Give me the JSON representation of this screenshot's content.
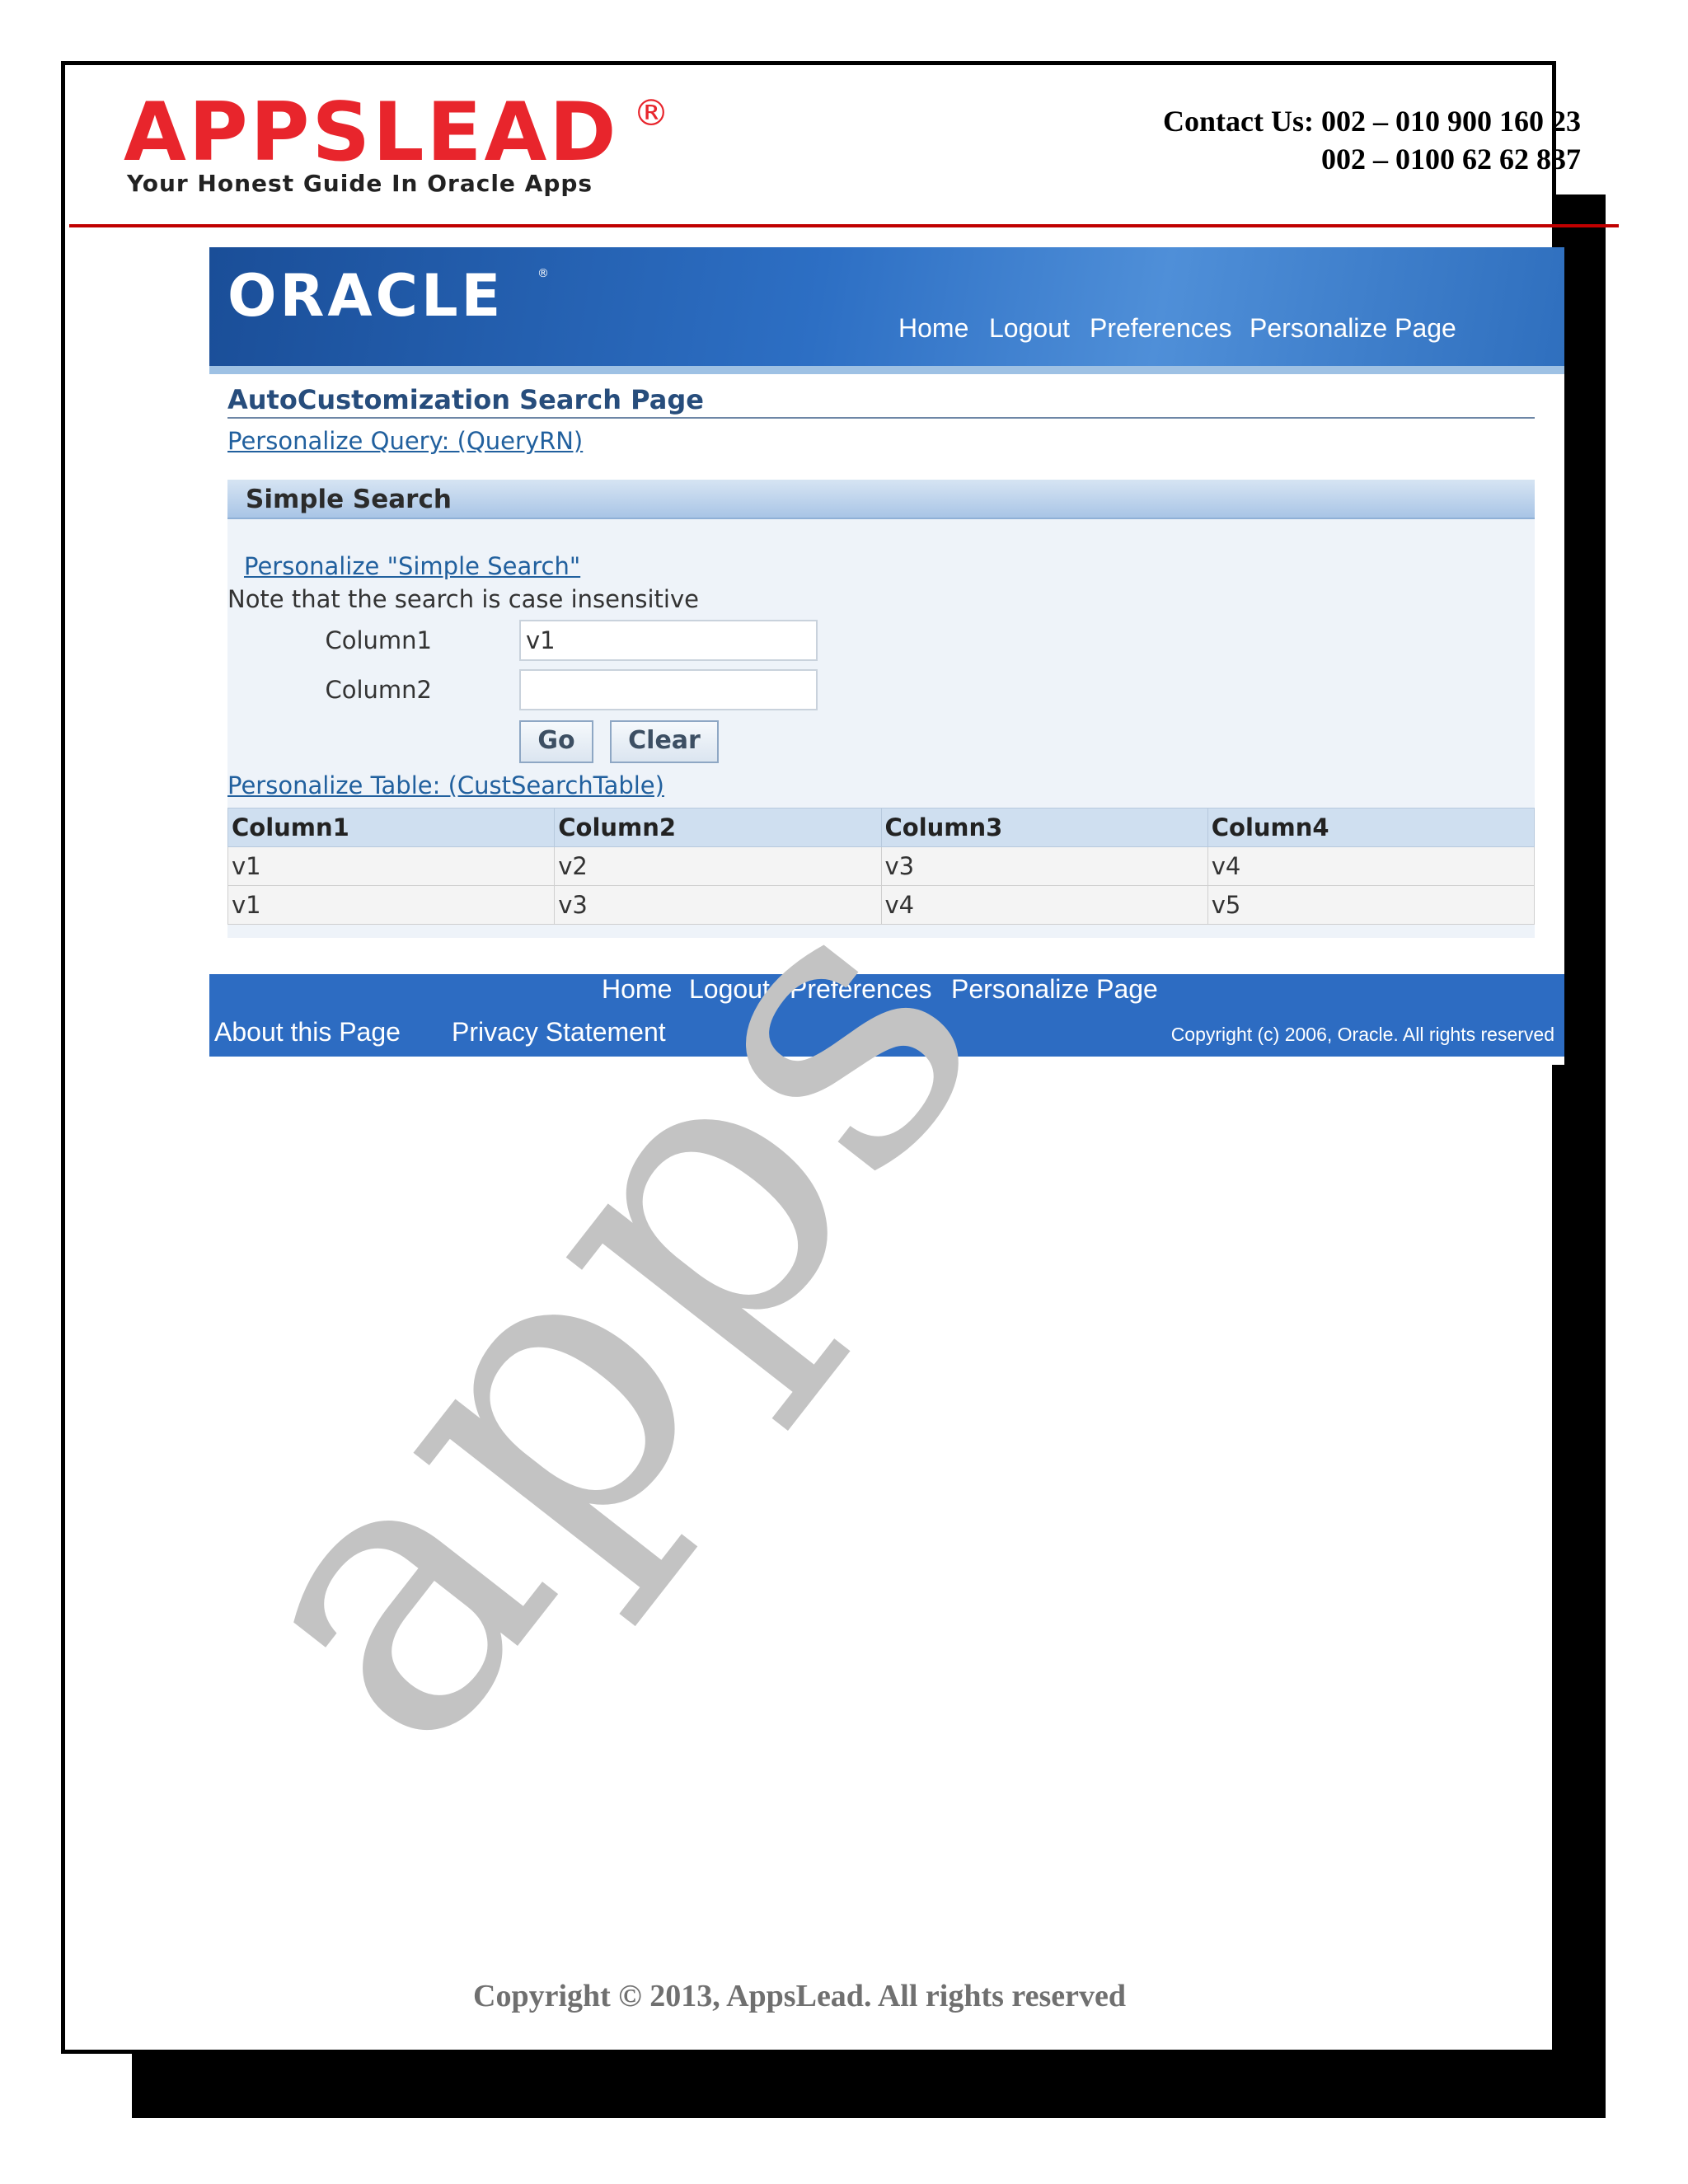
{
  "header": {
    "brand": "APPSLEAD",
    "registered": "®",
    "tagline": "Your Honest Guide In Oracle Apps",
    "contact_line1": "Contact Us: 002 – 010 900 160 23",
    "contact_line2": "002 – 0100 62 62 837",
    "accent_color": "#e8252c"
  },
  "app": {
    "brand": "ORACLE",
    "global_nav": [
      "Home",
      "Logout",
      "Preferences",
      "Personalize Page"
    ],
    "page_title": "AutoCustomization Search Page",
    "personalize_query_link": "Personalize Query: (QueryRN)",
    "search": {
      "region_title": "Simple Search",
      "personalize_link": "Personalize \"Simple Search\"",
      "note": "Note that the search is case insensitive",
      "fields": [
        {
          "label": "Column1",
          "value": "v1"
        },
        {
          "label": "Column2",
          "value": ""
        }
      ],
      "go_label": "Go",
      "clear_label": "Clear"
    },
    "personalize_table_link": "Personalize Table: (CustSearchTable)",
    "table": {
      "columns": [
        "Column1",
        "Column2",
        "Column3",
        "Column4"
      ],
      "rows": [
        [
          "v1",
          "v2",
          "v3",
          "v4"
        ],
        [
          "v1",
          "v3",
          "v4",
          "v5"
        ]
      ]
    },
    "footer": {
      "nav": [
        "Home",
        "Logout",
        "Preferences",
        "Personalize Page"
      ],
      "about": "About this Page",
      "privacy": "Privacy Statement",
      "copyright": "Copyright (c) 2006, Oracle. All rights reserved"
    }
  },
  "watermark": "apps",
  "document_copyright": "Copyright © 2013, AppsLead. All rights reserved"
}
